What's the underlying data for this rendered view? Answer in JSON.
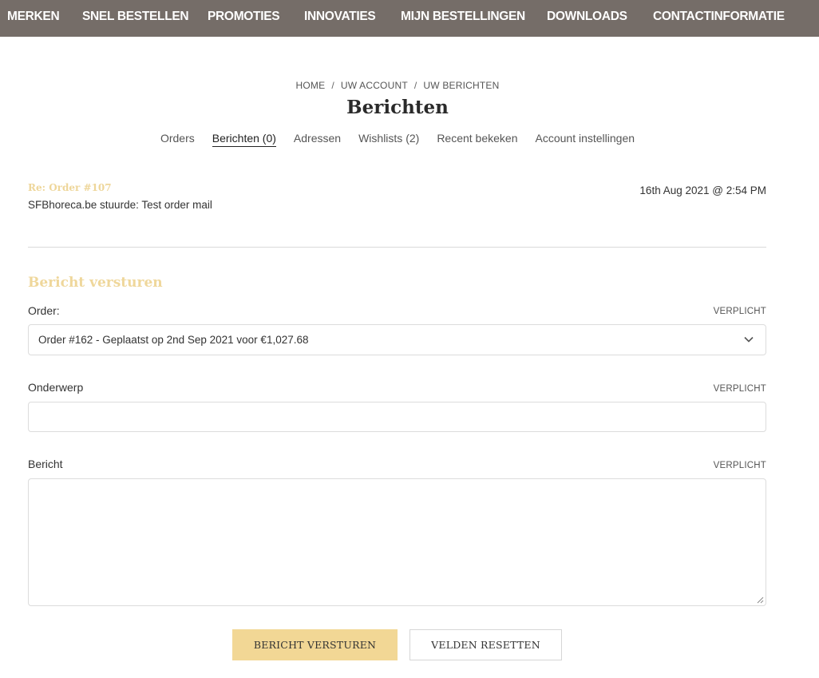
{
  "nav": {
    "items": [
      "MERKEN",
      "SNEL BESTELLEN",
      "PROMOTIES",
      "INNOVATIES",
      "MIJN BESTELLINGEN",
      "DOWNLOADS",
      "CONTACTINFORMATIE"
    ]
  },
  "breadcrumb": [
    "HOME",
    "UW ACCOUNT",
    "UW BERICHTEN"
  ],
  "page_title": "Berichten",
  "tabs": [
    "Orders",
    "Berichten (0)",
    "Adressen",
    "Wishlists (2)",
    "Recent bekeken",
    "Account instellingen"
  ],
  "message": {
    "subject": "Re: Order #107",
    "body": "SFBhoreca.be stuurde: Test order mail",
    "date": "16th Aug 2021 @ 2:54 PM"
  },
  "form": {
    "title": "Bericht versturen",
    "required_label": "VERPLICHT",
    "order_label": "Order:",
    "order_value": "Order #162 - Geplaatst op 2nd Sep 2021 voor €1,027.68",
    "subject_label": "Onderwerp",
    "subject_value": "",
    "message_label": "Bericht",
    "message_value": "",
    "submit_label": "BERICHT VERSTUREN",
    "reset_label": "VELDEN RESETTEN"
  },
  "colors": {
    "nav_bg": "#756d68",
    "accent": "#f2d795",
    "accent_text": "#efd79b"
  }
}
